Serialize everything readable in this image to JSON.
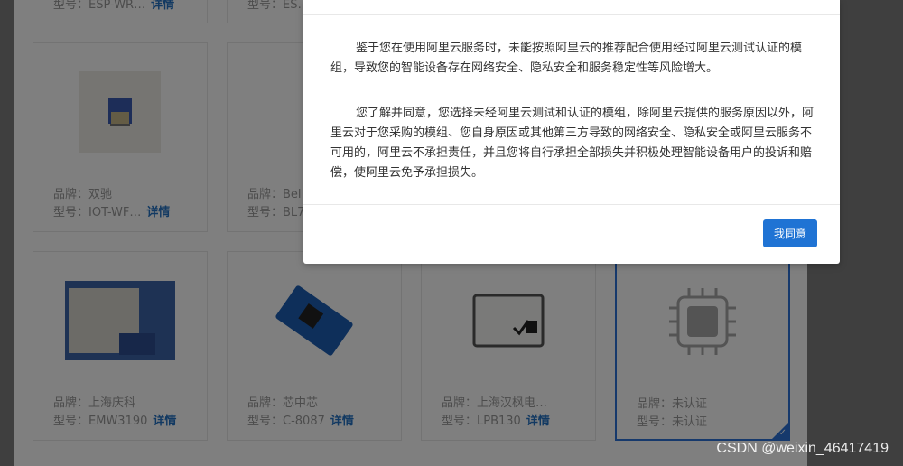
{
  "product_grid": {
    "top_row": [
      {
        "model_label": "型号：",
        "model": "ESP-WR…",
        "detail": "详情"
      },
      {
        "model_label": "型号：",
        "model": "ES…",
        "detail": ""
      }
    ],
    "row1": [
      {
        "brand_label": "品牌：",
        "brand": "双驰",
        "model_label": "型号：",
        "model": "IOT-WF…",
        "detail": "详情"
      },
      {
        "brand_label": "品牌：",
        "brand": "Bel…",
        "model_label": "型号：",
        "model": "BL7…",
        "detail": ""
      }
    ],
    "row2": [
      {
        "brand_label": "品牌：",
        "brand": "上海庆科",
        "model_label": "型号：",
        "model": "EMW3190",
        "detail": "详情"
      },
      {
        "brand_label": "品牌：",
        "brand": "芯中芯",
        "model_label": "型号：",
        "model": "C-8087",
        "detail": "详情"
      },
      {
        "brand_label": "品牌：",
        "brand": "上海汉枫电…",
        "model_label": "型号：",
        "model": "LPB130",
        "detail": "详情"
      },
      {
        "brand_label": "品牌：",
        "brand": "未认证",
        "model_label": "型号：",
        "model": "未认证",
        "detail": ""
      }
    ]
  },
  "modal": {
    "paragraph1": "鉴于您在使用阿里云服务时，未能按照阿里云的推荐配合使用经过阿里云测试认证的模组，导致您的智能设备存在网络安全、隐私安全和服务稳定性等风险增大。",
    "paragraph2": "您了解并同意，您选择未经阿里云测试和认证的模组，除阿里云提供的服务原因以外，阿里云对于您采购的模组、您自身原因或其他第三方导致的网络安全、隐私安全或阿里云服务不可用的，阿里云不承担责任，并且您将自行承担全部损失并积极处理智能设备用户的投诉和赔偿，使阿里云免予承担损失。",
    "agree_button": "我同意"
  },
  "watermark": "CSDN @weixin_46417419",
  "colors": {
    "accent": "#1f73d4",
    "link": "#2473c4",
    "overlay": "rgba(0,0,0,0.5)"
  }
}
